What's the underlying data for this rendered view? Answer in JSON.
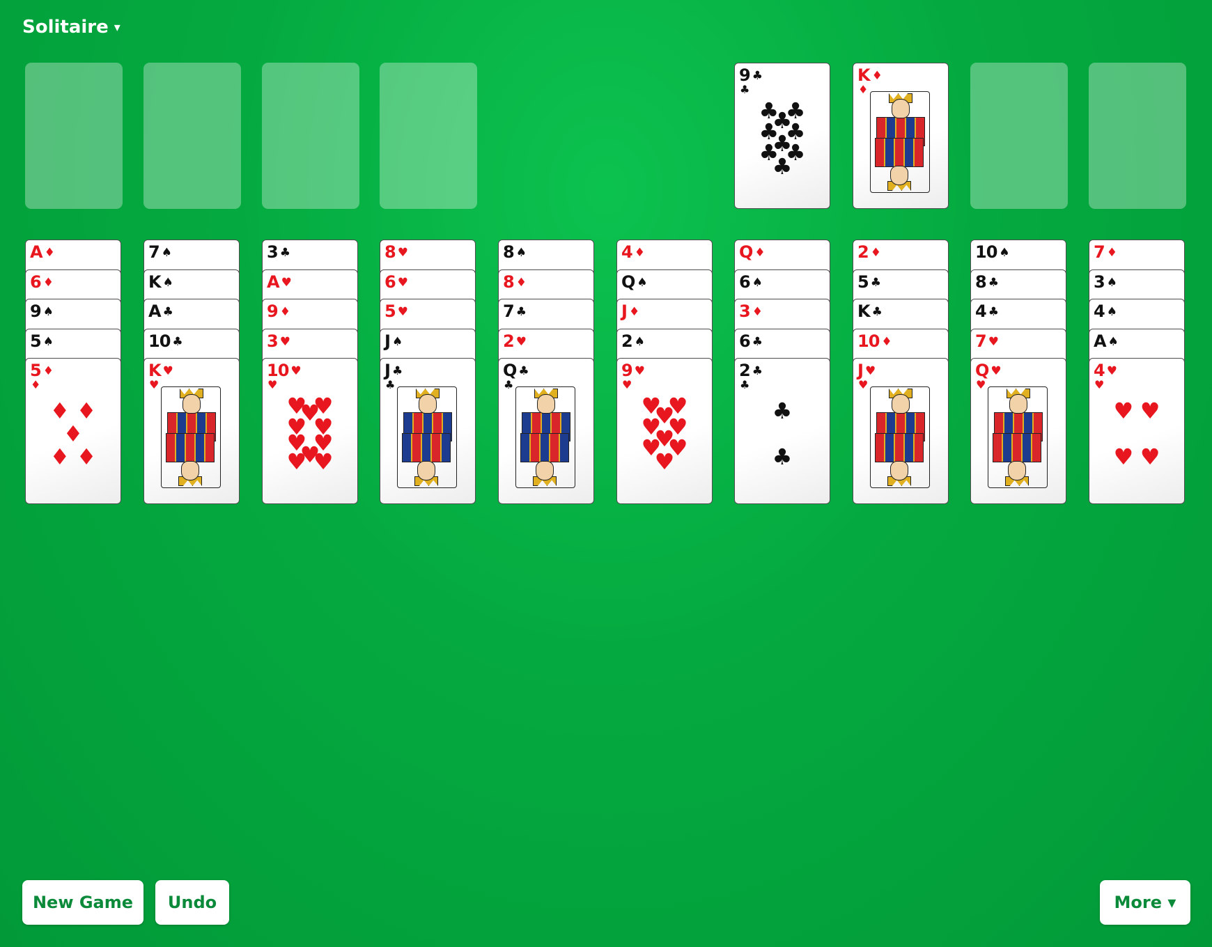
{
  "header": {
    "title": "Solitaire",
    "caret": "▾"
  },
  "freecells": [
    {},
    {},
    {},
    {}
  ],
  "foundations": [
    {
      "rank": "9",
      "suit": "♣",
      "color": "black"
    },
    {
      "rank": "K",
      "suit": "♦",
      "color": "red"
    },
    null,
    null
  ],
  "tableau": [
    [
      {
        "rank": "A",
        "suit": "♦",
        "color": "red"
      },
      {
        "rank": "6",
        "suit": "♦",
        "color": "red"
      },
      {
        "rank": "9",
        "suit": "♠",
        "color": "black"
      },
      {
        "rank": "5",
        "suit": "♠",
        "color": "black"
      },
      {
        "rank": "5",
        "suit": "♦",
        "color": "red"
      }
    ],
    [
      {
        "rank": "7",
        "suit": "♠",
        "color": "black"
      },
      {
        "rank": "K",
        "suit": "♠",
        "color": "black"
      },
      {
        "rank": "A",
        "suit": "♣",
        "color": "black"
      },
      {
        "rank": "10",
        "suit": "♣",
        "color": "black"
      },
      {
        "rank": "K",
        "suit": "♥",
        "color": "red"
      }
    ],
    [
      {
        "rank": "3",
        "suit": "♣",
        "color": "black"
      },
      {
        "rank": "A",
        "suit": "♥",
        "color": "red"
      },
      {
        "rank": "9",
        "suit": "♦",
        "color": "red"
      },
      {
        "rank": "3",
        "suit": "♥",
        "color": "red"
      },
      {
        "rank": "10",
        "suit": "♥",
        "color": "red"
      }
    ],
    [
      {
        "rank": "8",
        "suit": "♥",
        "color": "red"
      },
      {
        "rank": "6",
        "suit": "♥",
        "color": "red"
      },
      {
        "rank": "5",
        "suit": "♥",
        "color": "red"
      },
      {
        "rank": "J",
        "suit": "♠",
        "color": "black"
      },
      {
        "rank": "J",
        "suit": "♣",
        "color": "black"
      }
    ],
    [
      {
        "rank": "8",
        "suit": "♠",
        "color": "black"
      },
      {
        "rank": "8",
        "suit": "♦",
        "color": "red"
      },
      {
        "rank": "7",
        "suit": "♣",
        "color": "black"
      },
      {
        "rank": "2",
        "suit": "♥",
        "color": "red"
      },
      {
        "rank": "Q",
        "suit": "♣",
        "color": "black"
      }
    ],
    [
      {
        "rank": "4",
        "suit": "♦",
        "color": "red"
      },
      {
        "rank": "Q",
        "suit": "♠",
        "color": "black"
      },
      {
        "rank": "J",
        "suit": "♦",
        "color": "red"
      },
      {
        "rank": "2",
        "suit": "♠",
        "color": "black"
      },
      {
        "rank": "9",
        "suit": "♥",
        "color": "red"
      }
    ],
    [
      {
        "rank": "Q",
        "suit": "♦",
        "color": "red"
      },
      {
        "rank": "6",
        "suit": "♠",
        "color": "black"
      },
      {
        "rank": "3",
        "suit": "♦",
        "color": "red"
      },
      {
        "rank": "6",
        "suit": "♣",
        "color": "black"
      },
      {
        "rank": "2",
        "suit": "♣",
        "color": "black"
      }
    ],
    [
      {
        "rank": "2",
        "suit": "♦",
        "color": "red"
      },
      {
        "rank": "5",
        "suit": "♣",
        "color": "black"
      },
      {
        "rank": "K",
        "suit": "♣",
        "color": "black"
      },
      {
        "rank": "10",
        "suit": "♦",
        "color": "red"
      },
      {
        "rank": "J",
        "suit": "♥",
        "color": "red"
      }
    ],
    [
      {
        "rank": "10",
        "suit": "♠",
        "color": "black"
      },
      {
        "rank": "8",
        "suit": "♣",
        "color": "black"
      },
      {
        "rank": "4",
        "suit": "♣",
        "color": "black"
      },
      {
        "rank": "7",
        "suit": "♥",
        "color": "red"
      },
      {
        "rank": "Q",
        "suit": "♥",
        "color": "red"
      }
    ],
    [
      {
        "rank": "7",
        "suit": "♦",
        "color": "red"
      },
      {
        "rank": "3",
        "suit": "♠",
        "color": "black"
      },
      {
        "rank": "4",
        "suit": "♠",
        "color": "black"
      },
      {
        "rank": "A",
        "suit": "♠",
        "color": "black"
      },
      {
        "rank": "4",
        "suit": "♥",
        "color": "red"
      }
    ]
  ],
  "buttons": {
    "new_game": "New Game",
    "undo": "Undo",
    "more": "More ▾"
  },
  "colors": {
    "felt": "#04a93f",
    "red_suit": "#e8161e",
    "black_suit": "#111111",
    "button_text": "#0b8a3a"
  }
}
